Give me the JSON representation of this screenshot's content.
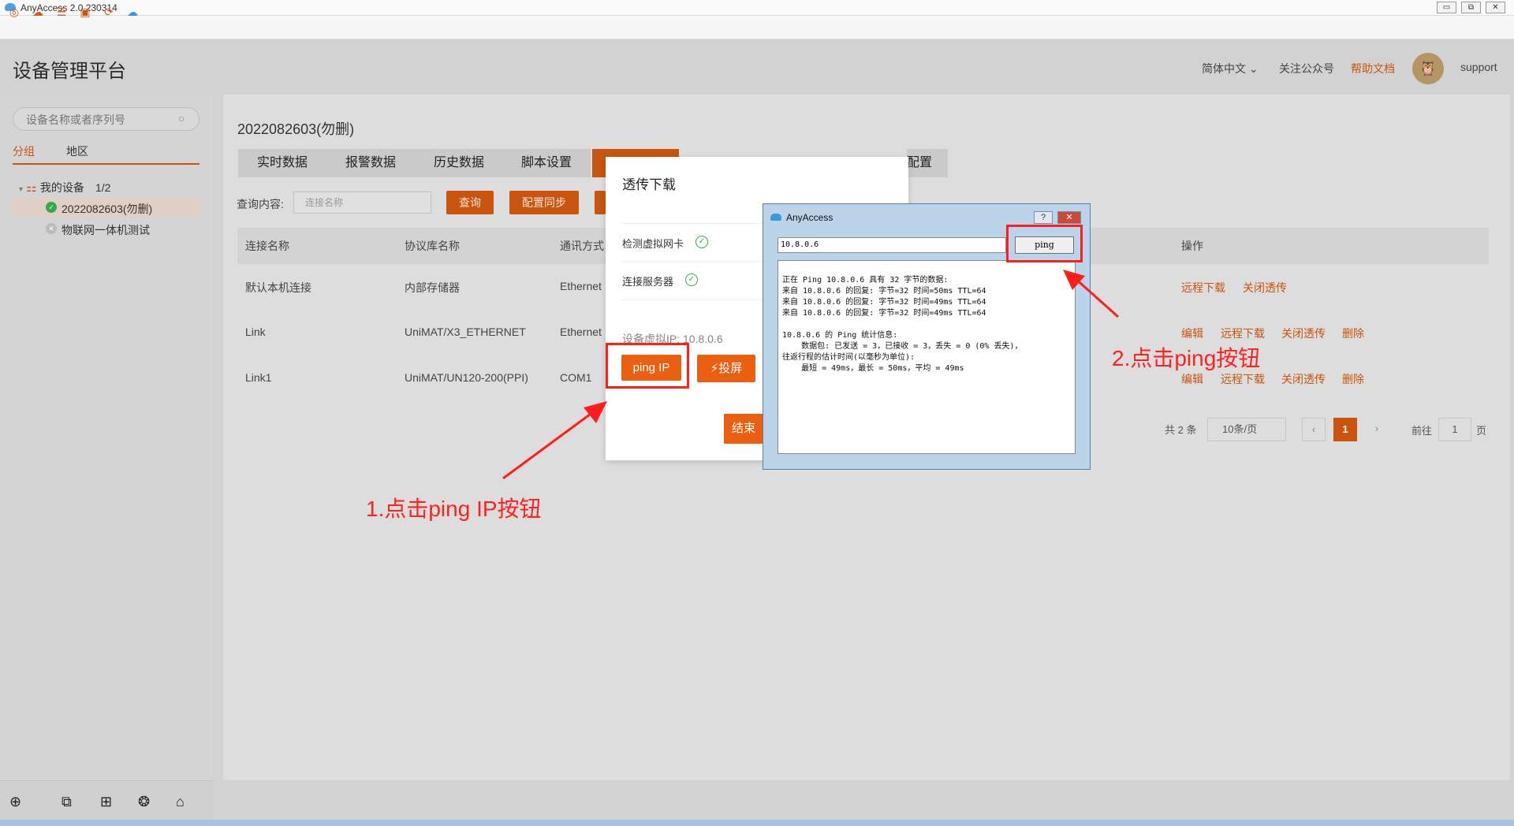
{
  "window": {
    "title": "AnyAccess 2.0.230314",
    "buttons": [
      "▭",
      "⧉",
      "✕"
    ]
  },
  "toolbar": {
    "icons": [
      "settings-circle-icon",
      "cloud-icon",
      "sliders-icon",
      "monitor-icon",
      "refresh-icon",
      "cloud-sync-icon"
    ]
  },
  "header": {
    "platform_title": "设备管理平台",
    "language": "简体中文",
    "follow": "关注公众号",
    "help": "帮助文档",
    "user": "support"
  },
  "sidebar": {
    "search_placeholder": "设备名称或者序列号",
    "tabs": [
      "分组",
      "地区"
    ],
    "group": {
      "label": "我的设备",
      "count": "1/2"
    },
    "devices": [
      "2022082603(勿删)",
      "物联网一体机测试"
    ]
  },
  "main": {
    "device_title": "2022082603(勿删)",
    "tabs": [
      "实时数据",
      "报警数据",
      "历史数据",
      "脚本设置",
      "",
      "配置"
    ],
    "query_label": "查询内容:",
    "query_placeholder": "连接名称",
    "query_button": "查询",
    "sync_button": "配置同步",
    "table": {
      "headers": [
        "连接名称",
        "协议库名称",
        "通讯方式",
        "操作"
      ],
      "rows": [
        {
          "name": "默认本机连接",
          "protocol": "内部存储器",
          "comm": "Ethernet",
          "ops": [
            "远程下载",
            "关闭透传"
          ]
        },
        {
          "name": "Link",
          "protocol": "UniMAT/X3_ETHERNET",
          "comm": "Ethernet",
          "ops": [
            "编辑",
            "远程下载",
            "关闭透传",
            "删除"
          ]
        },
        {
          "name": "Link1",
          "protocol": "UniMAT/UN120-200(PPI)",
          "comm": "COM1",
          "ops": [
            "编辑",
            "远程下载",
            "关闭透传",
            "删除"
          ]
        }
      ]
    },
    "pagination": {
      "total": "共 2 条",
      "page_size": "10条/页",
      "current": "1",
      "goto_label": "前往",
      "goto_value": "1",
      "page_unit": "页"
    }
  },
  "modal": {
    "title": "透传下载",
    "check1": "检测虚拟网卡",
    "check2": "连接服务器",
    "vip": "设备虚拟IP: 10.8.0.6",
    "ping_ip_button": "ping IP",
    "screen_button": "投屏",
    "end_button": "结束"
  },
  "ping_window": {
    "title": "AnyAccess",
    "address": "10.8.0.6",
    "ping_button": "ping",
    "output": "正在 Ping 10.8.0.6 具有 32 字节的数据:\n来自 10.8.0.6 的回复: 字节=32 时间=50ms TTL=64\n来自 10.8.0.6 的回复: 字节=32 时间=49ms TTL=64\n来自 10.8.0.6 的回复: 字节=32 时间=49ms TTL=64\n\n10.8.0.6 的 Ping 统计信息:\n    数据包: 已发送 = 3，已接收 = 3，丢失 = 0 (0% 丢失)，\n往返行程的估计时间(以毫秒为单位):\n    最短 = 49ms，最长 = 50ms，平均 = 49ms"
  },
  "annotations": {
    "step1": "1.点击ping IP按钮",
    "step2": "2.点击ping按钮"
  },
  "colors": {
    "accent": "#c9540e",
    "annotation": "#ff1d1d",
    "ok": "#36a84f"
  }
}
